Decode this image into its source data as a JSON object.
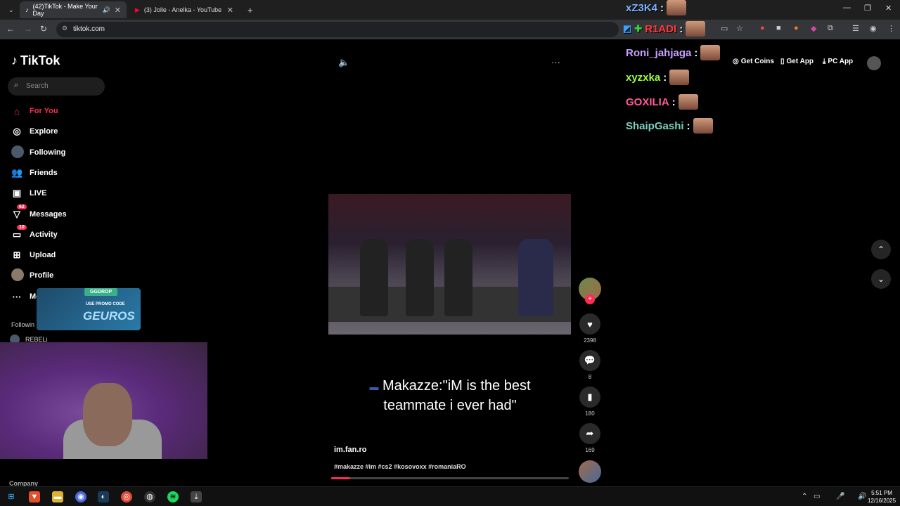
{
  "browser": {
    "tabs": [
      {
        "label": "(42)TikTok - Make Your Day",
        "active": true
      },
      {
        "label": "(3) Jolle - Anelka - YouTube",
        "active": false
      }
    ],
    "url": "tiktok.com"
  },
  "sidebar": {
    "logo": "TikTok",
    "search_placeholder": "Search",
    "items": [
      {
        "label": "For You",
        "icon": "home-icon",
        "active": true
      },
      {
        "label": "Explore",
        "icon": "compass-icon"
      },
      {
        "label": "Following",
        "icon": "following-avatar"
      },
      {
        "label": "Friends",
        "icon": "friends-icon"
      },
      {
        "label": "LIVE",
        "icon": "live-icon"
      },
      {
        "label": "Messages",
        "icon": "messages-icon",
        "badge": "62"
      },
      {
        "label": "Activity",
        "icon": "activity-icon",
        "badge": "10"
      },
      {
        "label": "Upload",
        "icon": "upload-icon"
      },
      {
        "label": "Profile",
        "icon": "profile-avatar"
      },
      {
        "label": "More",
        "icon": "more-icon"
      }
    ],
    "following_label": "Followin",
    "following_user": "REBELi",
    "footer": "Company"
  },
  "promo": {
    "tag": "GGDROP",
    "line": "USE PROMO CODE",
    "code": "GEUROS"
  },
  "header_right": {
    "coins": "Get Coins",
    "app": "Get App",
    "pc_app": "PC App"
  },
  "video": {
    "caption": "Makazze:\"iM is the best teammate i ever had\"",
    "author": "im.fan.ro",
    "hashtags": "#makazze #im #cs2 #kosovoxx #romaniaRO",
    "progress": 0.08,
    "likes": "2398",
    "comments": "8",
    "saves": "180",
    "shares": "169"
  },
  "chat": [
    {
      "user": "xZ3K4",
      "color": "#7ab0ff"
    },
    {
      "user": "R1ADI",
      "color": "#ff3a3a"
    },
    {
      "user": "Roni_jahjaga",
      "color": "#c8a0ff"
    },
    {
      "user": "xyzxka",
      "color": "#9aff3a"
    },
    {
      "user": "GOXILIA",
      "color": "#ff5a9a"
    },
    {
      "user": "ShaipGashi",
      "color": "#7ad0c0"
    }
  ],
  "taskbar": {
    "time": "5:51 PM",
    "date": "12/16/2025"
  },
  "colors": {
    "accent": "#fe2c55",
    "background": "#000000"
  }
}
